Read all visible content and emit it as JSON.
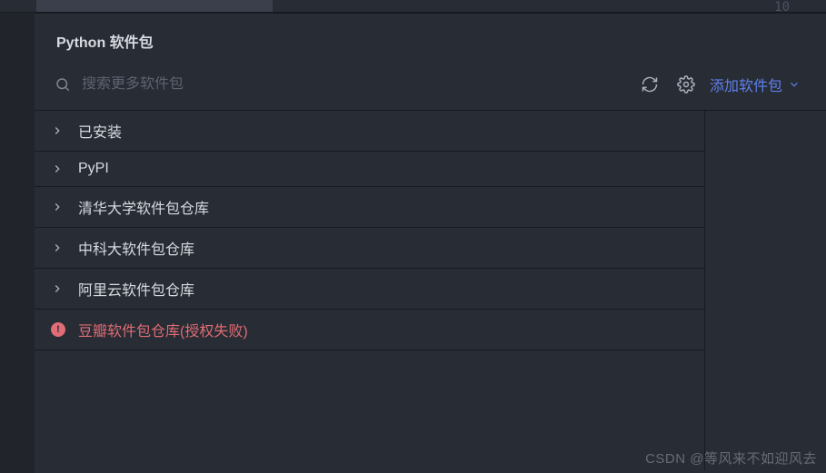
{
  "lineNumber": "10",
  "panel": {
    "title": "Python 软件包",
    "search": {
      "placeholder": "搜索更多软件包"
    },
    "addPackageLabel": "添加软件包"
  },
  "repos": [
    {
      "label": "已安装",
      "type": "expandable"
    },
    {
      "label": "PyPI",
      "type": "expandable"
    },
    {
      "label": "清华大学软件包仓库",
      "type": "expandable"
    },
    {
      "label": "中科大软件包仓库",
      "type": "expandable"
    },
    {
      "label": "阿里云软件包仓库",
      "type": "expandable"
    },
    {
      "label": "豆瓣软件包仓库(授权失败)",
      "type": "error"
    }
  ],
  "watermark": "CSDN @等风来不如迎风去"
}
